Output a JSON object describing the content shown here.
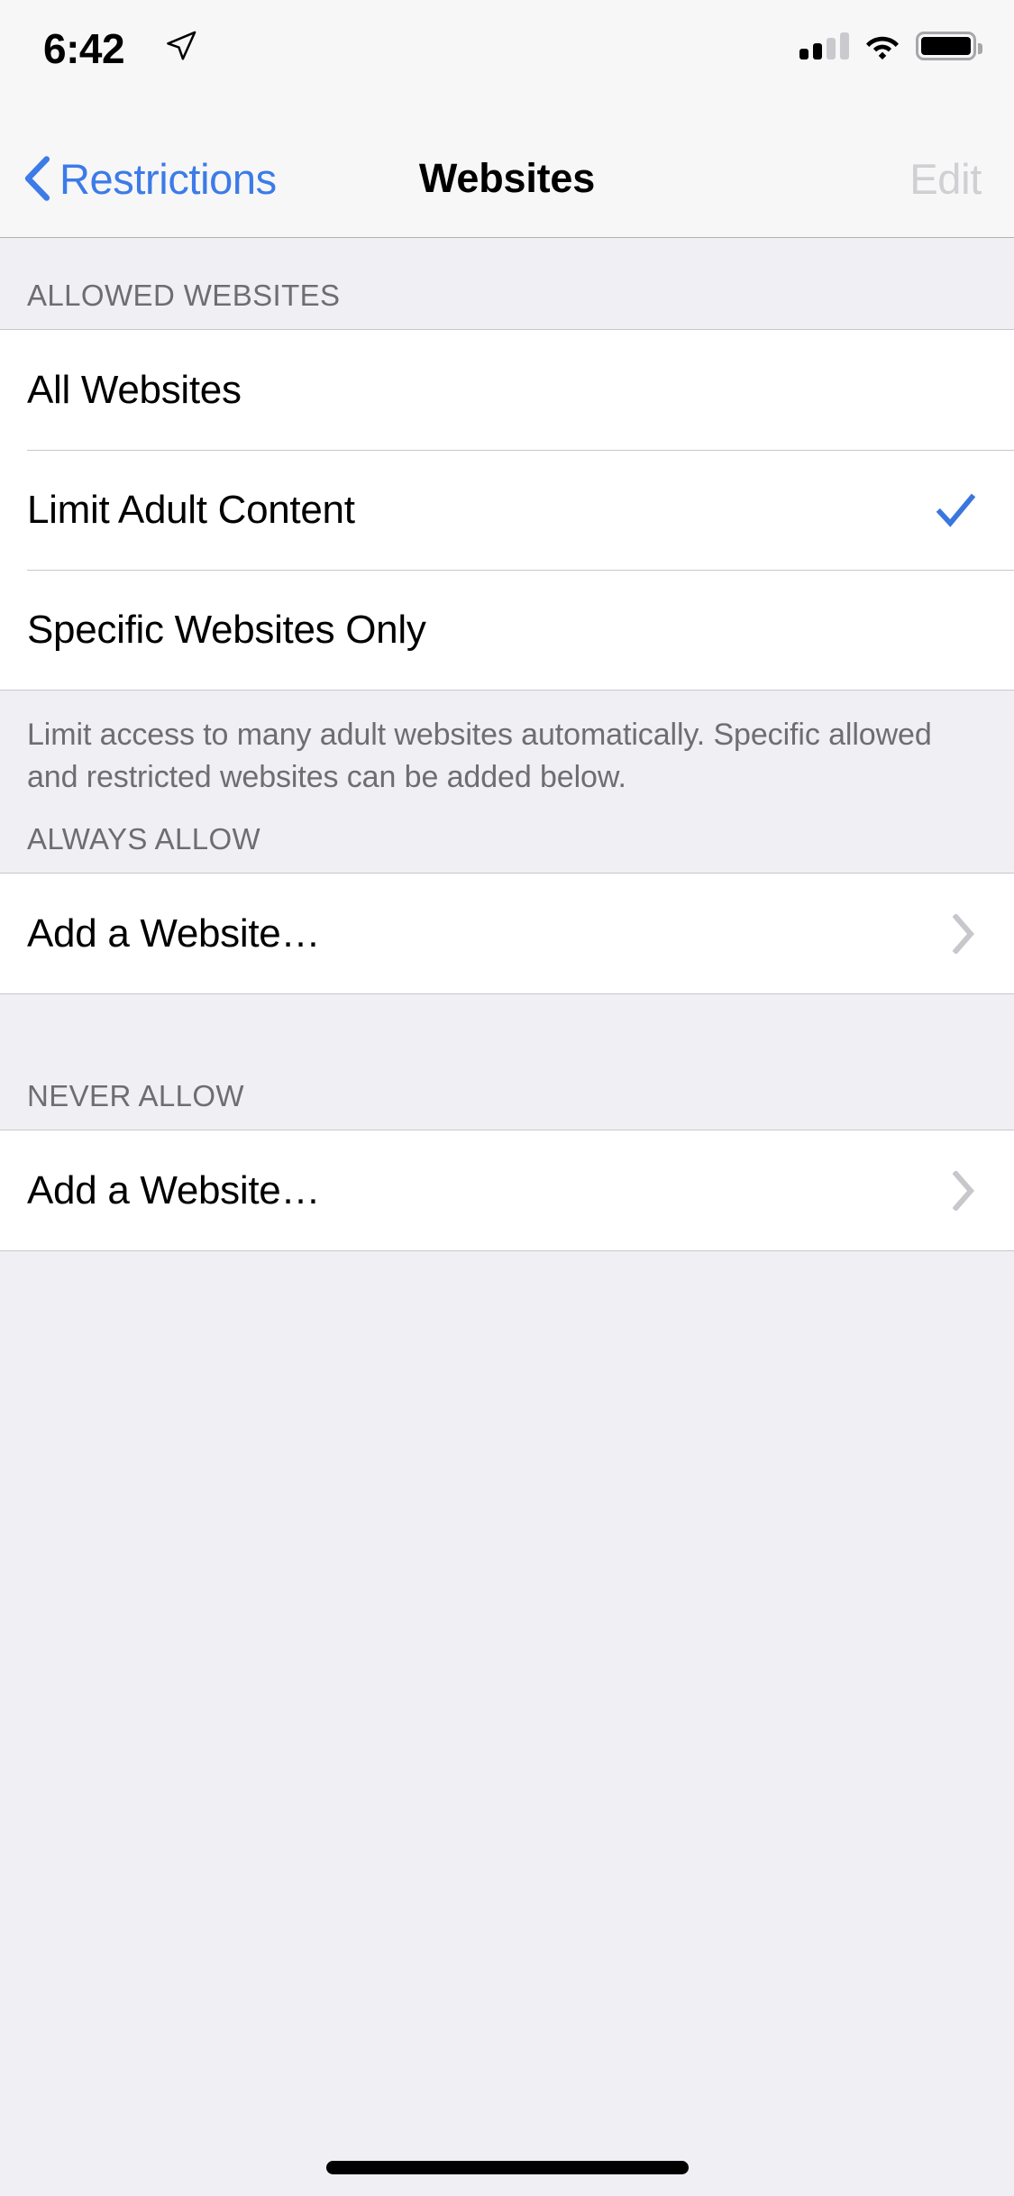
{
  "status_bar": {
    "time": "6:42",
    "location_icon": "location-arrow-icon",
    "cellular_icon": "cellular-signal-icon",
    "cellular_bars_filled": 2,
    "cellular_bars_total": 4,
    "wifi_icon": "wifi-icon",
    "battery_icon": "battery-icon",
    "battery_level_percent": 92
  },
  "nav_bar": {
    "back_label": "Restrictions",
    "back_icon": "chevron-left-icon",
    "title": "Websites",
    "edit_label": "Edit",
    "edit_enabled": false
  },
  "colors": {
    "accent_blue": "#3C7BE8",
    "checkmark_blue": "#3B76DE",
    "group_background": "#EFEFF4",
    "row_background": "#FFFFFF",
    "separator": "#C8C7CC",
    "secondary_text": "#6D6D72",
    "disabled_text": "#CFCFD4"
  },
  "sections": [
    {
      "header": "ALLOWED WEBSITES",
      "rows": [
        {
          "label": "All Websites",
          "accessory": "none",
          "selected": false
        },
        {
          "label": "Limit Adult Content",
          "accessory": "checkmark-icon",
          "selected": true
        },
        {
          "label": "Specific Websites Only",
          "accessory": "none",
          "selected": false
        }
      ],
      "footer": "Limit access to many adult websites automatically. Specific allowed and restricted websites can be added below."
    },
    {
      "header": "ALWAYS ALLOW",
      "rows": [
        {
          "label": "Add a Website…",
          "accessory": "chevron-right-icon",
          "selected": false
        }
      ],
      "footer": ""
    },
    {
      "header": "NEVER ALLOW",
      "rows": [
        {
          "label": "Add a Website…",
          "accessory": "chevron-right-icon",
          "selected": false
        }
      ],
      "footer": ""
    }
  ],
  "home_indicator": "home-indicator"
}
